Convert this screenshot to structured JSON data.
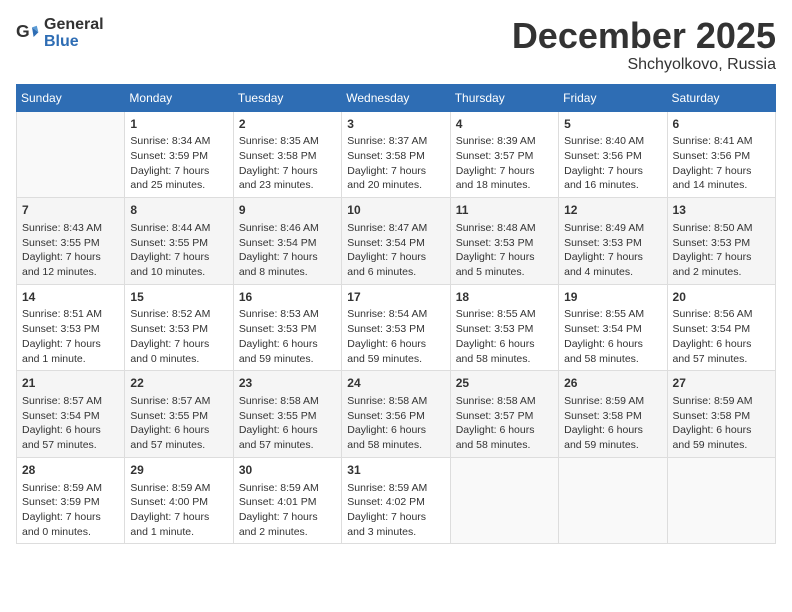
{
  "header": {
    "logo_general": "General",
    "logo_blue": "Blue",
    "month": "December 2025",
    "location": "Shchyolkovo, Russia"
  },
  "days_of_week": [
    "Sunday",
    "Monday",
    "Tuesday",
    "Wednesday",
    "Thursday",
    "Friday",
    "Saturday"
  ],
  "weeks": [
    [
      {
        "day": "",
        "info": ""
      },
      {
        "day": "1",
        "info": "Sunrise: 8:34 AM\nSunset: 3:59 PM\nDaylight: 7 hours\nand 25 minutes."
      },
      {
        "day": "2",
        "info": "Sunrise: 8:35 AM\nSunset: 3:58 PM\nDaylight: 7 hours\nand 23 minutes."
      },
      {
        "day": "3",
        "info": "Sunrise: 8:37 AM\nSunset: 3:58 PM\nDaylight: 7 hours\nand 20 minutes."
      },
      {
        "day": "4",
        "info": "Sunrise: 8:39 AM\nSunset: 3:57 PM\nDaylight: 7 hours\nand 18 minutes."
      },
      {
        "day": "5",
        "info": "Sunrise: 8:40 AM\nSunset: 3:56 PM\nDaylight: 7 hours\nand 16 minutes."
      },
      {
        "day": "6",
        "info": "Sunrise: 8:41 AM\nSunset: 3:56 PM\nDaylight: 7 hours\nand 14 minutes."
      }
    ],
    [
      {
        "day": "7",
        "info": "Sunrise: 8:43 AM\nSunset: 3:55 PM\nDaylight: 7 hours\nand 12 minutes."
      },
      {
        "day": "8",
        "info": "Sunrise: 8:44 AM\nSunset: 3:55 PM\nDaylight: 7 hours\nand 10 minutes."
      },
      {
        "day": "9",
        "info": "Sunrise: 8:46 AM\nSunset: 3:54 PM\nDaylight: 7 hours\nand 8 minutes."
      },
      {
        "day": "10",
        "info": "Sunrise: 8:47 AM\nSunset: 3:54 PM\nDaylight: 7 hours\nand 6 minutes."
      },
      {
        "day": "11",
        "info": "Sunrise: 8:48 AM\nSunset: 3:53 PM\nDaylight: 7 hours\nand 5 minutes."
      },
      {
        "day": "12",
        "info": "Sunrise: 8:49 AM\nSunset: 3:53 PM\nDaylight: 7 hours\nand 4 minutes."
      },
      {
        "day": "13",
        "info": "Sunrise: 8:50 AM\nSunset: 3:53 PM\nDaylight: 7 hours\nand 2 minutes."
      }
    ],
    [
      {
        "day": "14",
        "info": "Sunrise: 8:51 AM\nSunset: 3:53 PM\nDaylight: 7 hours\nand 1 minute."
      },
      {
        "day": "15",
        "info": "Sunrise: 8:52 AM\nSunset: 3:53 PM\nDaylight: 7 hours\nand 0 minutes."
      },
      {
        "day": "16",
        "info": "Sunrise: 8:53 AM\nSunset: 3:53 PM\nDaylight: 6 hours\nand 59 minutes."
      },
      {
        "day": "17",
        "info": "Sunrise: 8:54 AM\nSunset: 3:53 PM\nDaylight: 6 hours\nand 59 minutes."
      },
      {
        "day": "18",
        "info": "Sunrise: 8:55 AM\nSunset: 3:53 PM\nDaylight: 6 hours\nand 58 minutes."
      },
      {
        "day": "19",
        "info": "Sunrise: 8:55 AM\nSunset: 3:54 PM\nDaylight: 6 hours\nand 58 minutes."
      },
      {
        "day": "20",
        "info": "Sunrise: 8:56 AM\nSunset: 3:54 PM\nDaylight: 6 hours\nand 57 minutes."
      }
    ],
    [
      {
        "day": "21",
        "info": "Sunrise: 8:57 AM\nSunset: 3:54 PM\nDaylight: 6 hours\nand 57 minutes."
      },
      {
        "day": "22",
        "info": "Sunrise: 8:57 AM\nSunset: 3:55 PM\nDaylight: 6 hours\nand 57 minutes."
      },
      {
        "day": "23",
        "info": "Sunrise: 8:58 AM\nSunset: 3:55 PM\nDaylight: 6 hours\nand 57 minutes."
      },
      {
        "day": "24",
        "info": "Sunrise: 8:58 AM\nSunset: 3:56 PM\nDaylight: 6 hours\nand 58 minutes."
      },
      {
        "day": "25",
        "info": "Sunrise: 8:58 AM\nSunset: 3:57 PM\nDaylight: 6 hours\nand 58 minutes."
      },
      {
        "day": "26",
        "info": "Sunrise: 8:59 AM\nSunset: 3:58 PM\nDaylight: 6 hours\nand 59 minutes."
      },
      {
        "day": "27",
        "info": "Sunrise: 8:59 AM\nSunset: 3:58 PM\nDaylight: 6 hours\nand 59 minutes."
      }
    ],
    [
      {
        "day": "28",
        "info": "Sunrise: 8:59 AM\nSunset: 3:59 PM\nDaylight: 7 hours\nand 0 minutes."
      },
      {
        "day": "29",
        "info": "Sunrise: 8:59 AM\nSunset: 4:00 PM\nDaylight: 7 hours\nand 1 minute."
      },
      {
        "day": "30",
        "info": "Sunrise: 8:59 AM\nSunset: 4:01 PM\nDaylight: 7 hours\nand 2 minutes."
      },
      {
        "day": "31",
        "info": "Sunrise: 8:59 AM\nSunset: 4:02 PM\nDaylight: 7 hours\nand 3 minutes."
      },
      {
        "day": "",
        "info": ""
      },
      {
        "day": "",
        "info": ""
      },
      {
        "day": "",
        "info": ""
      }
    ]
  ]
}
